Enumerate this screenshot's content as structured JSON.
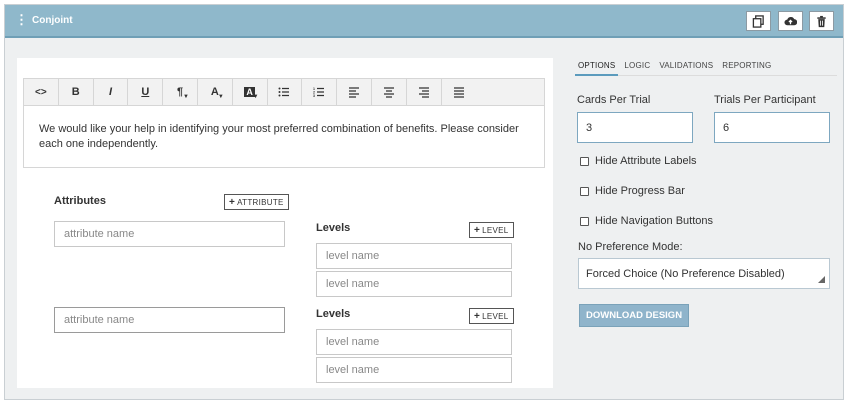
{
  "header": {
    "title": "Conjoint",
    "menu_icon": "kebab-icon",
    "buttons": [
      "copy-icon",
      "upload-icon",
      "trash-icon"
    ]
  },
  "editor": {
    "toolbar": [
      {
        "name": "code-icon",
        "label": "<>"
      },
      {
        "name": "bold-icon",
        "label": "B"
      },
      {
        "name": "italic-icon",
        "label": "I"
      },
      {
        "name": "underline-icon",
        "label": "U"
      },
      {
        "name": "paragraph-icon",
        "label": "¶"
      },
      {
        "name": "font-color-icon",
        "label": "A"
      },
      {
        "name": "highlight-icon",
        "label": "A"
      },
      {
        "name": "bullet-list-icon",
        "label": ""
      },
      {
        "name": "numbered-list-icon",
        "label": ""
      },
      {
        "name": "align-left-icon",
        "label": ""
      },
      {
        "name": "align-center-icon",
        "label": ""
      },
      {
        "name": "align-right-icon",
        "label": ""
      },
      {
        "name": "justify-icon",
        "label": ""
      }
    ],
    "content": "We would like your help in identifying your most preferred combination of benefits. Please consider each one independently."
  },
  "attributes": {
    "heading": "Attributes",
    "add_attribute_label": "ATTRIBUTE",
    "attribute_placeholder": "attribute name",
    "levels_label": "Levels",
    "add_level_label": "LEVEL",
    "level_placeholder": "level name"
  },
  "options": {
    "tabs": [
      "OPTIONS",
      "LOGIC",
      "VALIDATIONS",
      "REPORTING"
    ],
    "active_tab": "OPTIONS",
    "cards_per_trial_label": "Cards Per Trial",
    "cards_per_trial_value": "3",
    "trials_per_participant_label": "Trials Per Participant",
    "trials_per_participant_value": "6",
    "checkboxes": [
      {
        "label": "Hide Attribute Labels",
        "checked": false
      },
      {
        "label": "Hide Progress Bar",
        "checked": false
      },
      {
        "label": "Hide Navigation Buttons",
        "checked": false
      }
    ],
    "no_preference_label": "No Preference Mode:",
    "no_preference_value": "Forced Choice (No Preference Disabled)",
    "download_label": "DOWNLOAD DESIGN"
  },
  "colors": {
    "header_bg": "#8fb8cb",
    "accent": "#5b9bbd",
    "button_bg": "#8fb4cb"
  }
}
